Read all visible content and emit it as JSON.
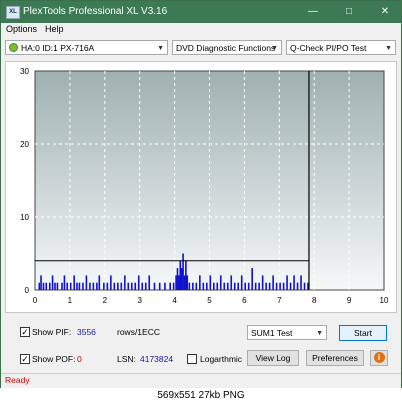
{
  "window": {
    "title": "PlexTools Professional XL V3.16",
    "icon_label": "XL",
    "controls": {
      "minimize": "—",
      "maximize": "□",
      "close": "✕"
    }
  },
  "menu": {
    "items": [
      "Options",
      "Help"
    ]
  },
  "toolbar": {
    "drive": "HA:0 ID:1  PX-716A",
    "function": "DVD Diagnostic Functions",
    "test": "Q-Check PI/PO Test"
  },
  "chart_data": {
    "type": "bar",
    "title": "",
    "xlabel": "",
    "ylabel": "",
    "xlim": [
      0,
      10
    ],
    "ylim": [
      0,
      30
    ],
    "xticks": [
      0,
      1,
      2,
      3,
      4,
      5,
      6,
      7,
      8,
      9,
      10
    ],
    "yticks": [
      0,
      10,
      20,
      30
    ],
    "grid": true,
    "threshold": 4,
    "data_end": 7.85,
    "colors": {
      "bars": "#1010d0",
      "threshold_line": "#000000",
      "plot_bg_top": "#9fb0b0",
      "plot_bg_bottom": "#f5f8f8"
    },
    "series": [
      {
        "values": [
          [
            0.1,
            1
          ],
          [
            0.15,
            2
          ],
          [
            0.22,
            1
          ],
          [
            0.3,
            1
          ],
          [
            0.4,
            1
          ],
          [
            0.48,
            2
          ],
          [
            0.55,
            1
          ],
          [
            0.62,
            1
          ],
          [
            0.75,
            1
          ],
          [
            0.82,
            2
          ],
          [
            0.9,
            1
          ],
          [
            1.0,
            1
          ],
          [
            1.1,
            2
          ],
          [
            1.18,
            1
          ],
          [
            1.25,
            1
          ],
          [
            1.35,
            1
          ],
          [
            1.45,
            2
          ],
          [
            1.55,
            1
          ],
          [
            1.65,
            1
          ],
          [
            1.75,
            1
          ],
          [
            1.82,
            2
          ],
          [
            1.95,
            1
          ],
          [
            2.05,
            1
          ],
          [
            2.15,
            2
          ],
          [
            2.25,
            1
          ],
          [
            2.35,
            1
          ],
          [
            2.45,
            1
          ],
          [
            2.55,
            2
          ],
          [
            2.65,
            1
          ],
          [
            2.75,
            1
          ],
          [
            2.85,
            1
          ],
          [
            2.95,
            2
          ],
          [
            3.05,
            1
          ],
          [
            3.15,
            1
          ],
          [
            3.25,
            2
          ],
          [
            3.4,
            1
          ],
          [
            3.55,
            1
          ],
          [
            3.7,
            1
          ],
          [
            3.85,
            1
          ],
          [
            3.95,
            1
          ],
          [
            4.02,
            2
          ],
          [
            4.06,
            3
          ],
          [
            4.1,
            2
          ],
          [
            4.14,
            4
          ],
          [
            4.18,
            3
          ],
          [
            4.22,
            5
          ],
          [
            4.26,
            2
          ],
          [
            4.3,
            4
          ],
          [
            4.34,
            2
          ],
          [
            4.4,
            1
          ],
          [
            4.5,
            1
          ],
          [
            4.6,
            1
          ],
          [
            4.7,
            2
          ],
          [
            4.8,
            1
          ],
          [
            4.9,
            1
          ],
          [
            5.0,
            2
          ],
          [
            5.1,
            1
          ],
          [
            5.2,
            1
          ],
          [
            5.3,
            2
          ],
          [
            5.4,
            1
          ],
          [
            5.5,
            1
          ],
          [
            5.6,
            2
          ],
          [
            5.7,
            1
          ],
          [
            5.8,
            1
          ],
          [
            5.9,
            2
          ],
          [
            6.0,
            1
          ],
          [
            6.1,
            1
          ],
          [
            6.2,
            3
          ],
          [
            6.3,
            1
          ],
          [
            6.4,
            1
          ],
          [
            6.5,
            2
          ],
          [
            6.6,
            1
          ],
          [
            6.7,
            1
          ],
          [
            6.8,
            2
          ],
          [
            6.9,
            1
          ],
          [
            7.0,
            1
          ],
          [
            7.1,
            1
          ],
          [
            7.2,
            2
          ],
          [
            7.3,
            1
          ],
          [
            7.4,
            2
          ],
          [
            7.5,
            1
          ],
          [
            7.6,
            2
          ],
          [
            7.7,
            1
          ],
          [
            7.8,
            1
          ]
        ]
      }
    ]
  },
  "controls": {
    "show_pif_label": "Show PIF:",
    "pif_value": "3556",
    "pif_unit": "rows/1ECC",
    "show_pof_label": "Show POF:",
    "pof_value": "0",
    "lsn_label": "LSN:",
    "lsn_value": "4173824",
    "logarithmic_label": "Logarthmic",
    "mode_select": "SUM1 Test",
    "start_button": "Start",
    "view_log_button": "View Log",
    "preferences_button": "Preferences",
    "info_icon": "i"
  },
  "status": {
    "text": "Ready"
  },
  "caption": {
    "text": "569x551  27kb  PNG"
  }
}
